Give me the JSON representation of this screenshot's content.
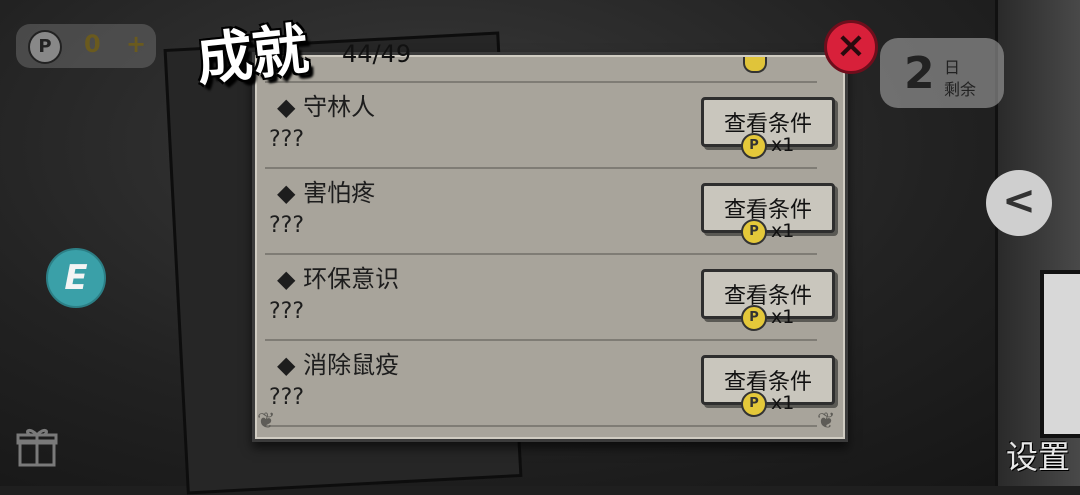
{
  "hud": {
    "coins": "0",
    "coin_plus": "+",
    "coin_symbol": "P",
    "days_number": "2",
    "days_label_1": "日",
    "days_label_2": "剩余",
    "e_button_label": "E",
    "back_arrow": "<",
    "settings_label": "设置"
  },
  "dialog": {
    "title": "成就",
    "progress": "44/49",
    "close_symbol": "×"
  },
  "achievements": [
    {
      "name": "◆ 守林人",
      "desc": "???",
      "button": "查看条件",
      "cost_symbol": "P",
      "cost": "x1"
    },
    {
      "name": "◆ 害怕疼",
      "desc": "???",
      "button": "查看条件",
      "cost_symbol": "P",
      "cost": "x1"
    },
    {
      "name": "◆ 环保意识",
      "desc": "???",
      "button": "查看条件",
      "cost_symbol": "P",
      "cost": "x1"
    },
    {
      "name": "◆ 消除鼠疫",
      "desc": "???",
      "button": "查看条件",
      "cost_symbol": "P",
      "cost": "x1"
    }
  ],
  "colors": {
    "panel_bg": "#a8a49b",
    "close_red": "#d8203a",
    "coin_gold": "#e4c83a",
    "e_button_teal": "#3aa0a8"
  }
}
